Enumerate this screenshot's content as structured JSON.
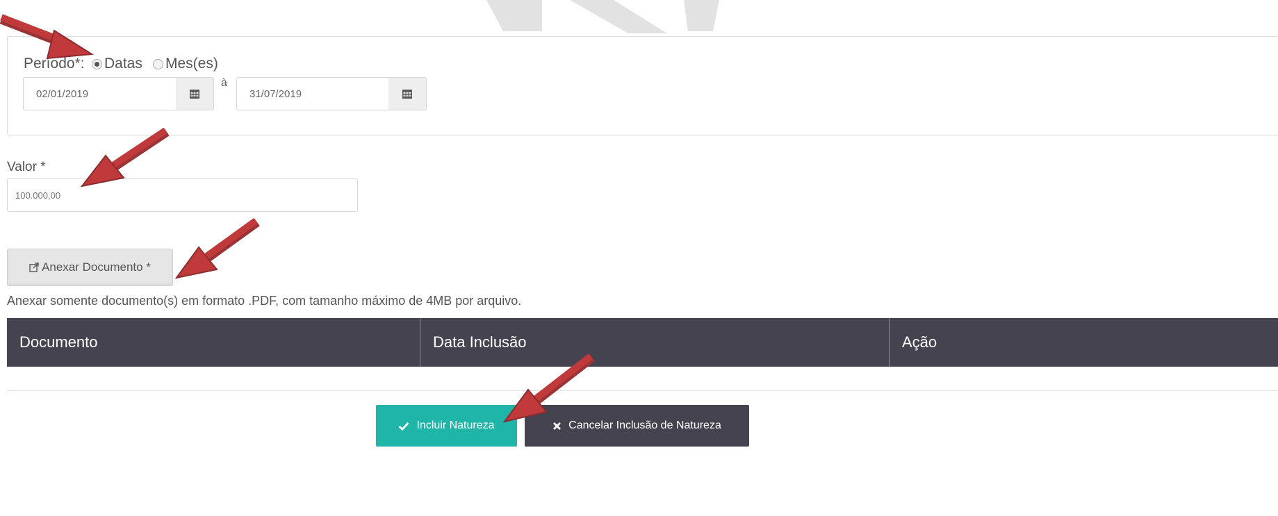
{
  "colors": {
    "accent_teal": "#1fb5a8",
    "dark": "#45434f",
    "annotation_arrow": "#c0393b"
  },
  "periodo": {
    "label": "Período*:",
    "options": [
      {
        "label": "Datas",
        "checked": true
      },
      {
        "label": "Mes(es)",
        "checked": false
      }
    ],
    "start_date": "02/01/2019",
    "separator": "à",
    "end_date": "31/07/2019",
    "calendar_icon": "calendar-icon"
  },
  "valor": {
    "label": "Valor *",
    "value": "100.000,00"
  },
  "anexar": {
    "button_label": "Anexar Documento *",
    "icon": "external-link-icon",
    "hint": "Anexar somente documento(s) em formato .PDF, com tamanho máximo de 4MB por arquivo."
  },
  "table": {
    "columns": [
      "Documento",
      "Data Inclusão",
      "Ação"
    ]
  },
  "actions": {
    "incluir_label": "Incluir Natureza",
    "incluir_icon": "check-icon",
    "cancelar_label": "Cancelar Inclusão de Natureza",
    "cancelar_icon": "close-icon"
  }
}
